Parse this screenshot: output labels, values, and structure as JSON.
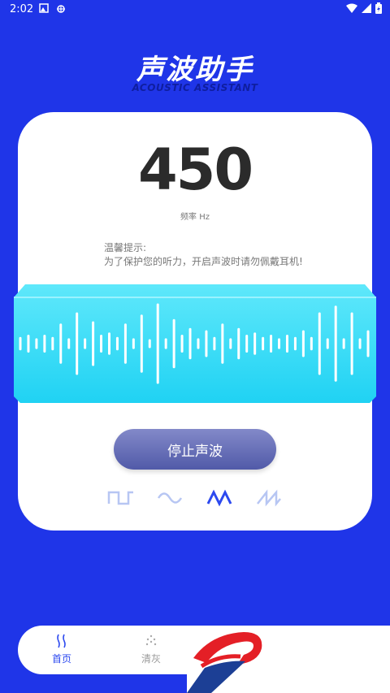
{
  "status_bar": {
    "time": "2:02"
  },
  "header": {
    "title": "声波助手",
    "subtitle": "ACOUSTIC ASSISTANT"
  },
  "frequency": {
    "value": "450",
    "label": "频率 Hz"
  },
  "tip": {
    "title": "温馨提示:",
    "text": "为了保护您的听力，开启声波时请勿佩戴耳机!"
  },
  "wave_display": {
    "levels": [
      0.15,
      0.2,
      0.12,
      0.2,
      0.15,
      0.45,
      0.12,
      0.7,
      0.12,
      0.5,
      0.2,
      0.25,
      0.15,
      0.45,
      0.12,
      0.65,
      0.1,
      0.9,
      0.12,
      0.55,
      0.2,
      0.35,
      0.12,
      0.3,
      0.15,
      0.45,
      0.12,
      0.35,
      0.2,
      0.25,
      0.15,
      0.2,
      0.12,
      0.2,
      0.15,
      0.3,
      0.15,
      0.7,
      0.12,
      0.85,
      0.12,
      0.7,
      0.12,
      0.3
    ]
  },
  "controls": {
    "stop_label": "停止声波"
  },
  "waveform_types": [
    {
      "icon": "square-wave-icon",
      "selected": false
    },
    {
      "icon": "sine-wave-icon",
      "selected": false
    },
    {
      "icon": "triangle-wave-icon",
      "selected": true
    },
    {
      "icon": "sawtooth-wave-icon",
      "selected": false
    }
  ],
  "bottom_nav": [
    {
      "label": "首页",
      "icon": "sound-wave-icon",
      "active": true
    },
    {
      "label": "清灰",
      "icon": "dust-icon",
      "active": false
    }
  ],
  "colors": {
    "background": "#1f35e8",
    "wave_panel": "#27d9f5",
    "accent": "#2c49ef"
  }
}
